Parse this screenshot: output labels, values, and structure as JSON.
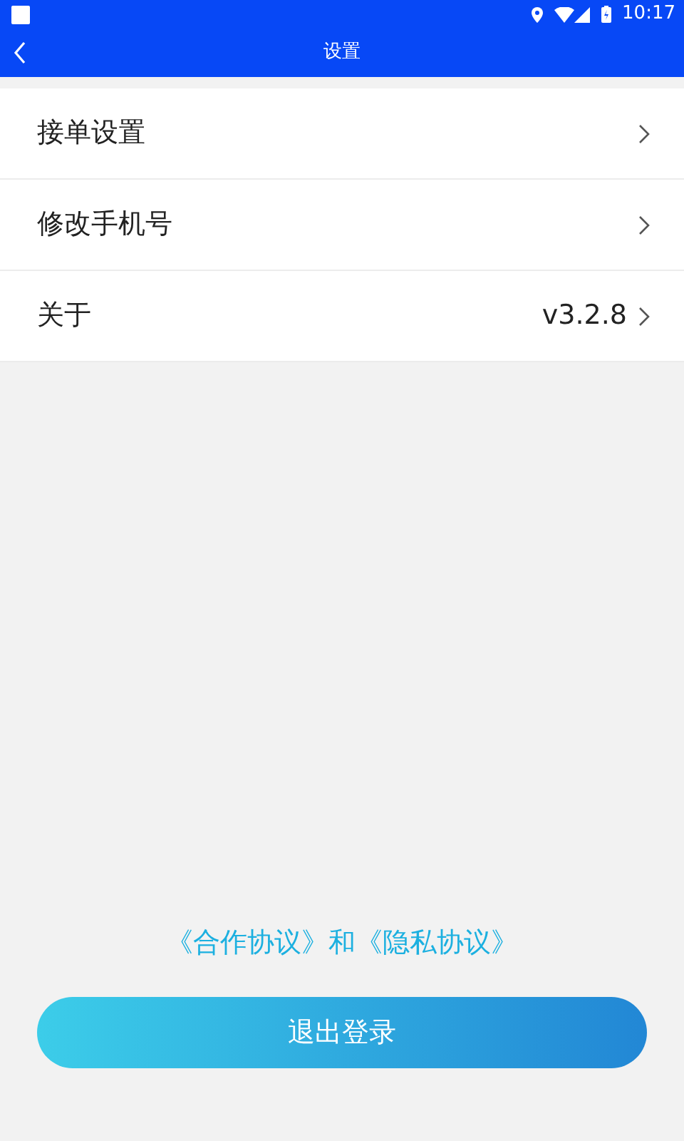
{
  "status_bar": {
    "time": "10:17"
  },
  "header": {
    "title": "设置"
  },
  "menu_items": [
    {
      "label": "接单设置"
    },
    {
      "label": "修改手机号"
    },
    {
      "label": "关于",
      "value": "v3.2.8"
    }
  ],
  "agreement": {
    "links": [
      "《合作协议》",
      "《隐私协议》"
    ],
    "joiner": "和"
  },
  "logout_button": "退出登录"
}
